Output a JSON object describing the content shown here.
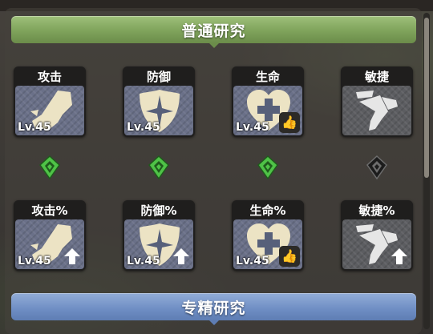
{
  "sections": {
    "normal": {
      "title": "普通研究"
    },
    "elite": {
      "title": "专精研究"
    }
  },
  "row1": [
    {
      "label": "攻击",
      "level": "Lv.45",
      "icon": "boot-icon",
      "recommended": false,
      "locked": false
    },
    {
      "label": "防御",
      "level": "Lv.45",
      "icon": "shield-icon",
      "recommended": false,
      "locked": false
    },
    {
      "label": "生命",
      "level": "Lv.45",
      "icon": "heart-cross-icon",
      "recommended": true,
      "locked": false
    },
    {
      "label": "敏捷",
      "level": "",
      "icon": "wing-icon",
      "recommended": false,
      "locked": true
    }
  ],
  "row2": [
    {
      "label": "攻击%",
      "level": "Lv.45",
      "icon": "boot-icon",
      "recommended": false,
      "locked": false
    },
    {
      "label": "防御%",
      "level": "Lv.45",
      "icon": "shield-icon",
      "recommended": false,
      "locked": false
    },
    {
      "label": "生命%",
      "level": "Lv.45",
      "icon": "heart-cross-icon",
      "recommended": true,
      "locked": false
    },
    {
      "label": "敏捷%",
      "level": "",
      "icon": "wing-icon",
      "recommended": false,
      "locked": true
    }
  ],
  "connectors": [
    {
      "state": "active",
      "icon": "green-gem-icon"
    },
    {
      "state": "active",
      "icon": "green-gem-icon"
    },
    {
      "state": "active",
      "icon": "green-gem-icon"
    },
    {
      "state": "inactive",
      "icon": "grey-gem-icon"
    }
  ],
  "colors": {
    "normal_header": "#7fa35b",
    "elite_header": "#6e8dc3",
    "connector_active": "#4fc247",
    "connector_inactive": "#1c1c1c",
    "thumb": "#f2a640"
  }
}
